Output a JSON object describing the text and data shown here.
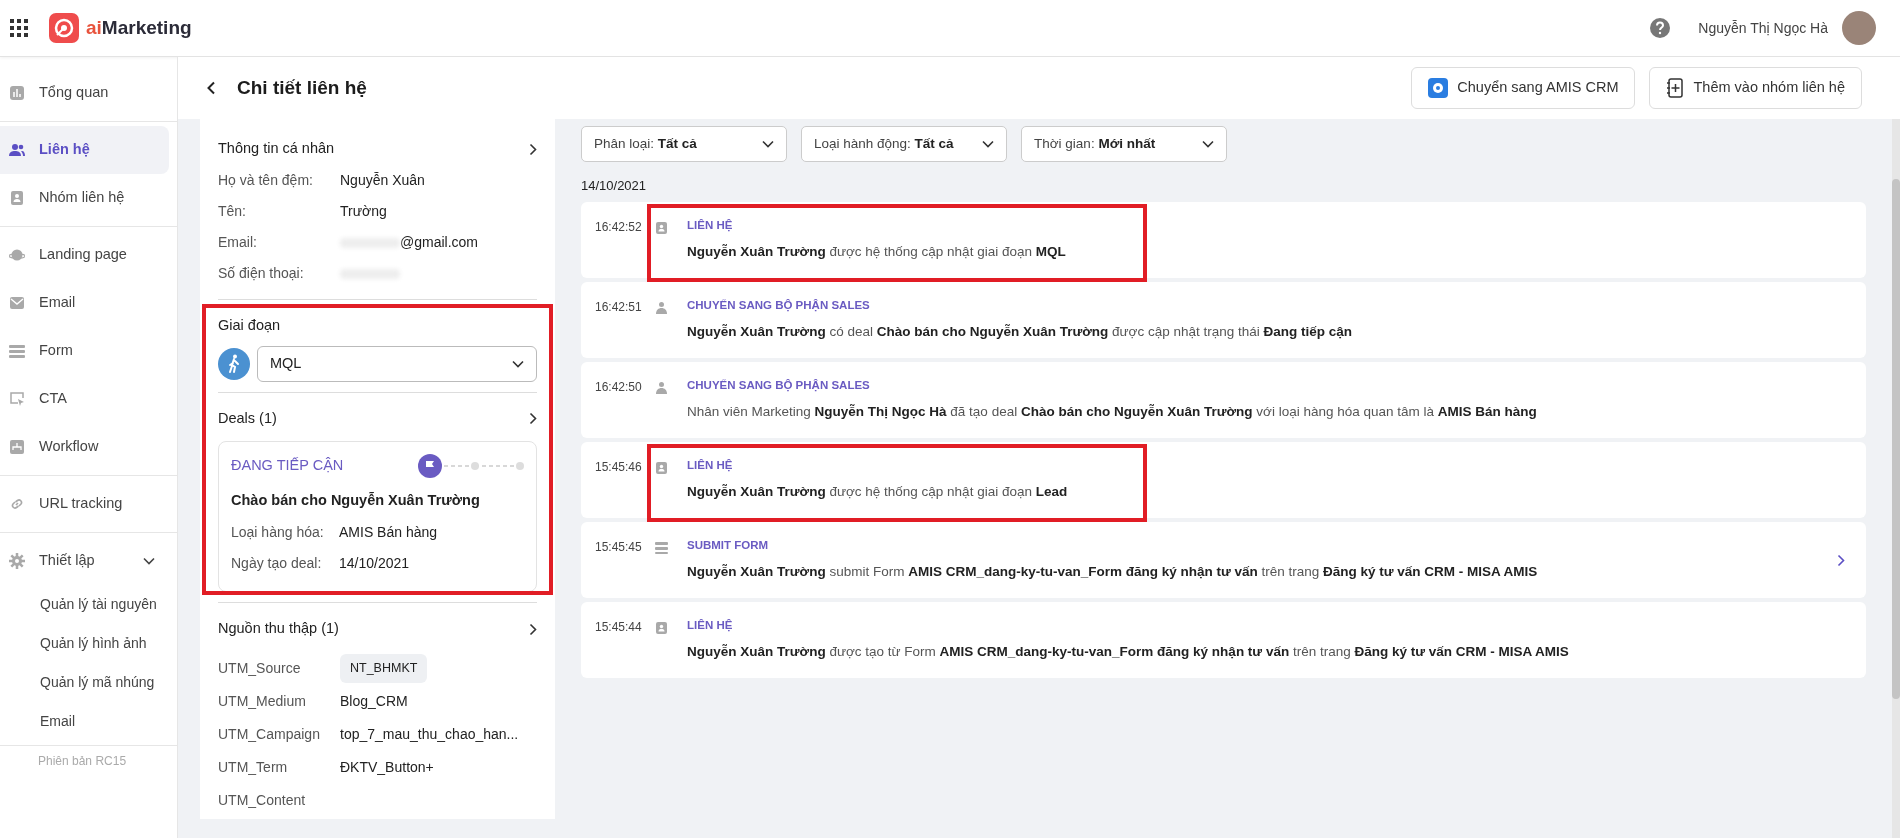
{
  "header": {
    "logo_prefix": "ai",
    "logo_name": "Marketing",
    "user_name": "Nguyễn Thị Ngọc Hà"
  },
  "sidebar": {
    "groups": [
      [
        {
          "label": "Tổng quan",
          "selected": false
        }
      ],
      [
        {
          "label": "Liên hệ",
          "selected": true
        },
        {
          "label": "Nhóm liên hệ",
          "selected": false
        }
      ],
      [
        {
          "label": "Landing page",
          "selected": false
        },
        {
          "label": "Email",
          "selected": false
        },
        {
          "label": "Form",
          "selected": false
        },
        {
          "label": "CTA",
          "selected": false
        },
        {
          "label": "Workflow",
          "selected": false
        }
      ],
      [
        {
          "label": "URL tracking",
          "selected": false
        }
      ],
      [
        {
          "label": "Thiết lập",
          "selected": false,
          "expanded": true,
          "children": [
            {
              "label": "Quản lý tài nguyên"
            },
            {
              "label": "Quản lý hình ảnh"
            },
            {
              "label": "Quản lý mã nhúng"
            },
            {
              "label": "Email"
            }
          ]
        }
      ]
    ],
    "version": "Phiên bản RC15"
  },
  "page": {
    "title": "Chi tiết liên hệ",
    "buttons": [
      {
        "label": "Chuyển sang AMIS CRM",
        "kind": "crm"
      },
      {
        "label": "Thêm vào nhóm liên hệ",
        "kind": "group"
      }
    ]
  },
  "personal": {
    "title": "Thông tin cá nhân",
    "fields": [
      {
        "label": "Họ và tên đệm:",
        "value": "Nguyễn Xuân"
      },
      {
        "label": "Tên:",
        "value": "Trường"
      },
      {
        "label": "Email:",
        "value": "@gmail.com",
        "redacted": true
      },
      {
        "label": "Số điện thoại:",
        "redacted": true
      }
    ]
  },
  "stage": {
    "title": "Giai đoạn",
    "value": "MQL",
    "highlighted": true
  },
  "deals": {
    "title": "Deals (1)",
    "items": [
      {
        "status": "ĐANG TIẾP CẬN",
        "steps": [
          {
            "done": true
          },
          {
            "done": false
          },
          {
            "done": false
          }
        ],
        "name": "Chào bán cho Nguyễn Xuân Trường",
        "fields": [
          {
            "label": "Loại hàng hóa:",
            "value": "AMIS Bán hàng"
          },
          {
            "label": "Ngày tạo deal:",
            "value": "14/10/2021"
          }
        ]
      }
    ]
  },
  "sources": {
    "title": "Nguồn thu thập (1)",
    "fields": [
      {
        "label": "UTM_Source",
        "value": "NT_BHMKT",
        "kind": "chip"
      },
      {
        "label": "UTM_Medium",
        "value": "Blog_CRM",
        "kind": "text"
      },
      {
        "label": "UTM_Campaign",
        "value": "top_7_mau_thu_chao_han...",
        "kind": "text"
      },
      {
        "label": "UTM_Term",
        "value": "ĐKTV_Button+",
        "kind": "text"
      },
      {
        "label": "UTM_Content"
      }
    ]
  },
  "filters": [
    {
      "label": "Phân loại:",
      "value": "Tất cả"
    },
    {
      "label": "Loại hành động:",
      "value": "Tất cả"
    },
    {
      "label": "Thời gian:",
      "value": "Mới nhất"
    }
  ],
  "timeline": {
    "date": "14/10/2021",
    "entries": [
      {
        "time": "16:42:52",
        "kind": "contact",
        "type": "LIÊN HỆ",
        "text": "**Nguyễn Xuân Trường** được hệ thống cập nhật giai đoạn **MQL**",
        "highlighted": true,
        "expandable": false
      },
      {
        "time": "16:42:51",
        "kind": "sales",
        "type": "CHUYỂN SANG BỘ PHẬN SALES",
        "text": "**Nguyễn Xuân Trường** có deal **Chào bán cho Nguyễn Xuân Trường** được cập nhật trạng thái **Đang tiếp cận**",
        "highlighted": false,
        "expandable": false
      },
      {
        "time": "16:42:50",
        "kind": "sales",
        "type": "CHUYỂN SANG BỘ PHẬN SALES",
        "text": "Nhân viên Marketing **Nguyễn Thị Ngọc Hà** đã tạo deal **Chào bán cho Nguyễn Xuân Trường** với loại hàng hóa quan tâm là **AMIS Bán hàng**",
        "highlighted": false,
        "expandable": false
      },
      {
        "time": "15:45:46",
        "kind": "contact",
        "type": "LIÊN HỆ",
        "text": "**Nguyễn Xuân Trường** được hệ thống cập nhật giai đoạn **Lead**",
        "highlighted": true,
        "expandable": false
      },
      {
        "time": "15:45:45",
        "kind": "form",
        "type": "SUBMIT FORM",
        "text": "**Nguyễn Xuân Trường** submit Form **AMIS CRM_dang-ky-tu-van_Form đăng ký nhận tư vấn** trên trang **Đăng ký tư vấn CRM - MISA AMIS**",
        "highlighted": false,
        "expandable": true
      },
      {
        "time": "15:45:44",
        "kind": "contact",
        "type": "LIÊN HỆ",
        "text": "**Nguyễn Xuân Trường** được tạo từ Form **AMIS CRM_dang-ky-tu-van_Form đăng ký nhận tư vấn** trên trang **Đăng ký tư vấn CRM - MISA AMIS**",
        "highlighted": false,
        "expandable": false
      }
    ]
  }
}
